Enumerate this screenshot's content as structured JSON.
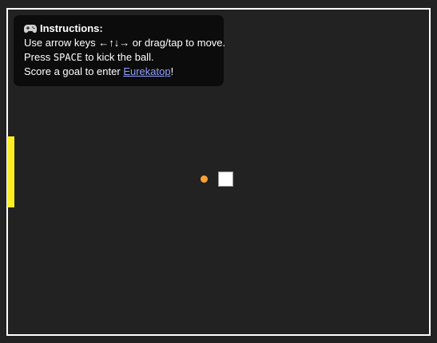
{
  "instructions": {
    "icon": "gamepad-icon",
    "title": "Instructions:",
    "line1": "Use arrow keys ←↑↓→ or drag/tap to move.",
    "line2_prefix": "Press ",
    "line2_key": "SPACE",
    "line2_suffix": " to kick the ball.",
    "line3_prefix": "Score a goal to enter ",
    "line3_link": "Eurekatop",
    "line3_suffix": "!"
  },
  "colors": {
    "background": "#222222",
    "field_border": "#ffffff",
    "panel": "#0c0c0c",
    "goal": "#ffee22",
    "ball": "#ffa133",
    "player": "#ffffff",
    "link": "#8ea0ff"
  }
}
